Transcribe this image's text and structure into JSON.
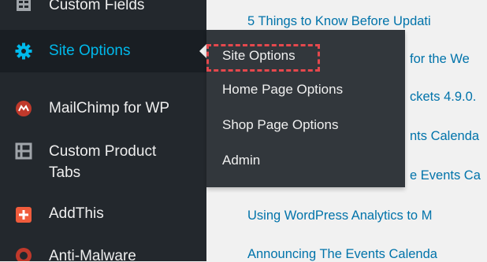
{
  "sidebar": {
    "items": [
      {
        "label": "Custom Fields",
        "icon": "custom-fields-icon"
      },
      {
        "label": "Site Options",
        "icon": "gear-icon"
      },
      {
        "label": "MailChimp for WP",
        "icon": "mailchimp-icon"
      },
      {
        "label": "Custom Product Tabs",
        "icon": "tabs-icon"
      },
      {
        "label": "AddThis",
        "icon": "addthis-icon"
      },
      {
        "label": "Anti-Malware",
        "icon": "anti-malware-icon"
      }
    ]
  },
  "submenu": {
    "items": [
      {
        "label": "Site Options"
      },
      {
        "label": "Home Page Options"
      },
      {
        "label": "Shop Page Options"
      },
      {
        "label": "Admin"
      }
    ]
  },
  "content": {
    "links": [
      "5 Things to Know Before Updati",
      "for the We",
      "ckets 4.9.0.",
      "nts Calenda",
      "e Events Ca",
      "Using WordPress Analytics to M",
      "Announcing The Events Calenda"
    ]
  },
  "colors": {
    "sidebar_bg": "#23282d",
    "active_bg": "#191e23",
    "active_text": "#00b9eb",
    "submenu_bg": "#32373c",
    "link": "#0073aa",
    "highlight": "#e5484d",
    "mailchimp": "#c0392b",
    "addthis": "#f05c3c"
  }
}
